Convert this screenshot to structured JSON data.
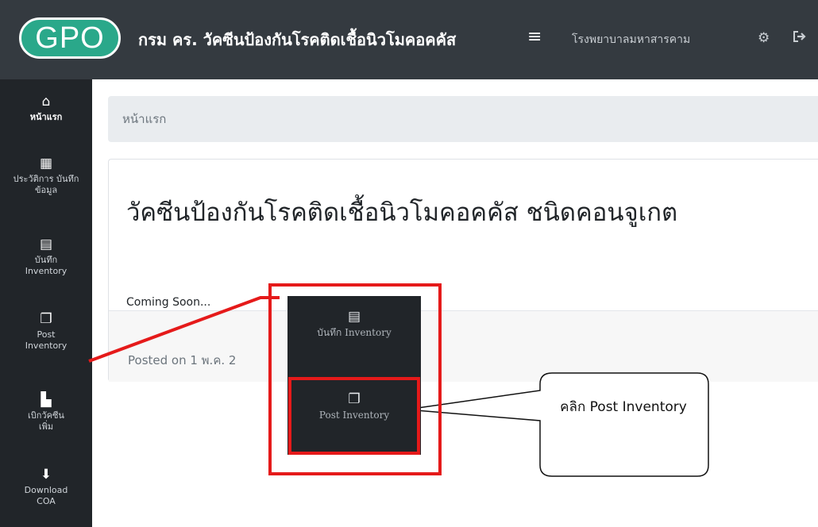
{
  "header": {
    "logo_text": "GPO",
    "title": "กรม คร. วัคซีนป้องกันโรคติดเชื้อนิวโมคอคคัส",
    "menu_icon": "≡",
    "hospital": "โรงพยาบาลมหาสารคาม",
    "settings_icon": "gear-icon",
    "logout_icon": "sign-out-icon"
  },
  "sidebar": {
    "items": [
      {
        "label": "หน้าแรก",
        "icon": "home-icon",
        "active": true
      },
      {
        "label": "ประวัติการ บันทึกข้อมูล",
        "icon": "calendar-icon"
      },
      {
        "label": "บันทึก Inventory",
        "icon": "clipboard-icon"
      },
      {
        "label": "Post Inventory",
        "icon": "copy-icon"
      },
      {
        "label": "เบิกวัคซีน เพิ่ม",
        "icon": "pdf-file-icon"
      },
      {
        "label": "Download COA",
        "icon": "download-file-icon"
      }
    ]
  },
  "breadcrumb": {
    "home": "หน้าแรก"
  },
  "card": {
    "title": "วัคซีนป้องกันโรคติดเชื้อนิวโมคอคคัส ชนิดคอนจูเกต",
    "text": "Coming Soon...",
    "footer": "Posted on 1 พ.ค. 2"
  },
  "zoom": {
    "items": [
      {
        "label": "บันทึก Inventory",
        "icon": "clipboard-icon"
      },
      {
        "label": "Post Inventory",
        "icon": "copy-icon"
      }
    ]
  },
  "callout": {
    "text": "คลิก Post Inventory"
  },
  "colors": {
    "navbar": "#343a40",
    "sidebar": "#212529",
    "brand": "#2aa88a",
    "highlight": "#e51a1a"
  }
}
